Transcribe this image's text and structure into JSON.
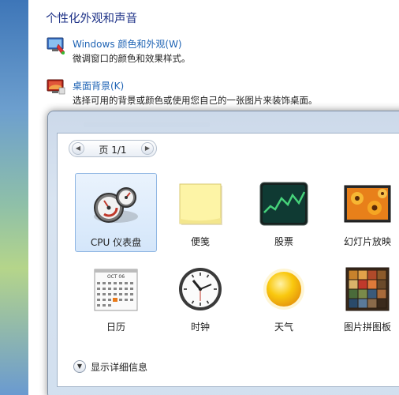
{
  "control_panel": {
    "heading": "个性化外观和声音",
    "items": [
      {
        "link": "Windows 颜色和外观(W)",
        "desc": "微调窗口的颜色和效果样式。",
        "icon": "color-appearance-icon"
      },
      {
        "link": "桌面背景(K)",
        "desc": "选择可用的背景或颜色或使用您自己的一张图片来装饰桌面。",
        "icon": "desktop-background-icon"
      }
    ]
  },
  "gallery": {
    "page_label": "页 1/1",
    "gadgets": [
      {
        "label": "CPU 仪表盘",
        "icon": "cpu-meter-icon",
        "selected": true
      },
      {
        "label": "便笺",
        "icon": "notes-icon",
        "selected": false
      },
      {
        "label": "股票",
        "icon": "stocks-icon",
        "selected": false
      },
      {
        "label": "幻灯片放映",
        "icon": "slideshow-icon",
        "selected": false
      },
      {
        "label": "日历",
        "icon": "calendar-icon",
        "selected": false
      },
      {
        "label": "时钟",
        "icon": "clock-icon",
        "selected": false
      },
      {
        "label": "天气",
        "icon": "weather-icon",
        "selected": false
      },
      {
        "label": "图片拼图板",
        "icon": "picture-puzzle-icon",
        "selected": false
      }
    ],
    "calendar_month": "OCT 06",
    "show_details_label": "显示详细信息"
  },
  "colors": {
    "heading": "#1e3287",
    "link": "#1e63b4",
    "selection": "#d4e6fa"
  }
}
